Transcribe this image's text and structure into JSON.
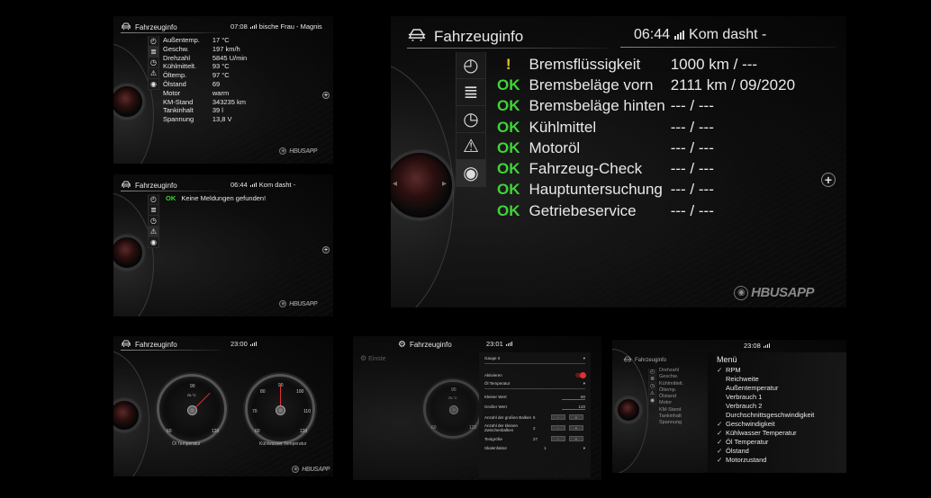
{
  "panel1": {
    "title": "Fahrzeuginfo",
    "status": "07:08",
    "status_extra": "bische Frau - Magnis",
    "rows": [
      {
        "label": "Außentemp.",
        "value": "17 °C"
      },
      {
        "label": "Geschw.",
        "value": "197 km/h"
      },
      {
        "label": "Drehzahl",
        "value": "5845 U/min"
      },
      {
        "label": "Kühlmittelt.",
        "value": "93 °C"
      },
      {
        "label": "Öltemp.",
        "value": "97 °C"
      },
      {
        "label": "Ölstand",
        "value": "69"
      },
      {
        "label": "Motor",
        "value": "warm"
      },
      {
        "label": "KM-Stand",
        "value": "343235 km"
      },
      {
        "label": "Tankinhalt",
        "value": "39 l"
      },
      {
        "label": "Spannung",
        "value": "13,8 V"
      }
    ],
    "brand": "HBUSAPP"
  },
  "panel2": {
    "title": "Fahrzeuginfo",
    "status": "06:44",
    "status_extra": "Kom dasht -",
    "ok": "OK",
    "message": "Keine Meldungen gefunden!",
    "brand": "HBUSAPP"
  },
  "panel3": {
    "title": "Fahrzeuginfo",
    "status": "06:44",
    "status_extra": "Kom dasht -",
    "rows": [
      {
        "status": "!",
        "kind": "warn",
        "label": "Bremsflüssigkeit",
        "value": "1000 km / ---"
      },
      {
        "status": "OK",
        "kind": "ok",
        "label": "Bremsbeläge vorn",
        "value": "2111 km / 09/2020"
      },
      {
        "status": "OK",
        "kind": "ok",
        "label": "Bremsbeläge hinten",
        "value": "--- / ---"
      },
      {
        "status": "OK",
        "kind": "ok",
        "label": "Kühlmittel",
        "value": "--- / ---"
      },
      {
        "status": "OK",
        "kind": "ok",
        "label": "Motoröl",
        "value": "--- / ---"
      },
      {
        "status": "OK",
        "kind": "ok",
        "label": "Fahrzeug-Check",
        "value": "--- / ---"
      },
      {
        "status": "OK",
        "kind": "ok",
        "label": "Hauptuntersuchung",
        "value": "--- / ---"
      },
      {
        "status": "OK",
        "kind": "ok",
        "label": "Getriebeservice",
        "value": "--- / ---"
      }
    ],
    "brand": "HBUSAPP"
  },
  "panel4": {
    "title": "Fahrzeuginfo",
    "status": "23:00",
    "gauge1": {
      "label": "Öl Temperatur",
      "ticks": [
        "60",
        "90",
        "120"
      ],
      "unit": "ÖL°C",
      "value": 100,
      "min": 60,
      "max": 120
    },
    "gauge2": {
      "label": "Kühlwasser Temperatur",
      "ticks": [
        "60",
        "70",
        "80",
        "90",
        "100",
        "110",
        "120"
      ],
      "value": 90,
      "min": 60,
      "max": 120
    },
    "brand": "HBUSAPP"
  },
  "panel5": {
    "title": "Fahrzeuginfo",
    "status": "23:01",
    "side_title": "Einste",
    "gauge_ticks": [
      "60",
      "90",
      "120"
    ],
    "gauge_unit": "ÖL°C",
    "gauge_select": "Gauge 3",
    "toggle_label": "Aktivieren",
    "sensor_select": "Öl Temperatur",
    "fields": [
      {
        "label": "Kleiner Wert",
        "value": "60"
      },
      {
        "label": "Großer Wert",
        "value": "120"
      }
    ],
    "steppers": [
      {
        "label": "Anzahl der großen Balken",
        "value": "5",
        "minus": "-",
        "plus": "+"
      },
      {
        "label": "Anzahl der kleinen Zwischenbalken",
        "value": "2",
        "minus": "-",
        "plus": "+"
      },
      {
        "label": "Textgröße",
        "value": "27",
        "minus": "-",
        "plus": "+"
      }
    ],
    "multiplier_label": "Skalenfaktor",
    "multiplier_value": "1"
  },
  "panel6": {
    "title": "Fahrzeuginfo",
    "status": "23:08",
    "left_items": [
      "Drehzahl",
      "Geschw.",
      "Kühlmittelt.",
      "Öltemp.",
      "Ölstand",
      "Motor",
      "KM-Stand",
      "Tankinhalt",
      "Spannung"
    ],
    "menu_title": "Menü",
    "menu": [
      {
        "checked": true,
        "label": "RPM"
      },
      {
        "checked": false,
        "label": "Reichweite"
      },
      {
        "checked": false,
        "label": "Außentemperatur"
      },
      {
        "checked": false,
        "label": "Verbrauch 1"
      },
      {
        "checked": false,
        "label": "Verbrauch 2"
      },
      {
        "checked": false,
        "label": "Durchschnittsgeschwindigkeit"
      },
      {
        "checked": true,
        "label": "Geschwindigkeit"
      },
      {
        "checked": true,
        "label": "Kühlwasser Temperatur"
      },
      {
        "checked": true,
        "label": "Öl Temperatur"
      },
      {
        "checked": true,
        "label": "Ölstand"
      },
      {
        "checked": true,
        "label": "Motorzustand"
      }
    ],
    "check": "✓"
  },
  "colors": {
    "ok": "#41d33a",
    "warn": "#f0c419",
    "bg": "#000000",
    "accent_red": "#e03030"
  }
}
